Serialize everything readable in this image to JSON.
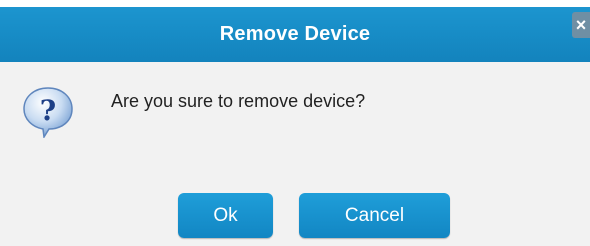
{
  "dialog": {
    "title": "Remove Device",
    "close_label": "×",
    "message": "Are you sure to remove device?",
    "icon": "question-icon",
    "buttons": {
      "ok": "Ok",
      "cancel": "Cancel"
    }
  },
  "colors": {
    "accent": "#1a8fca",
    "background": "#f2f2f2",
    "text": "#222222"
  }
}
